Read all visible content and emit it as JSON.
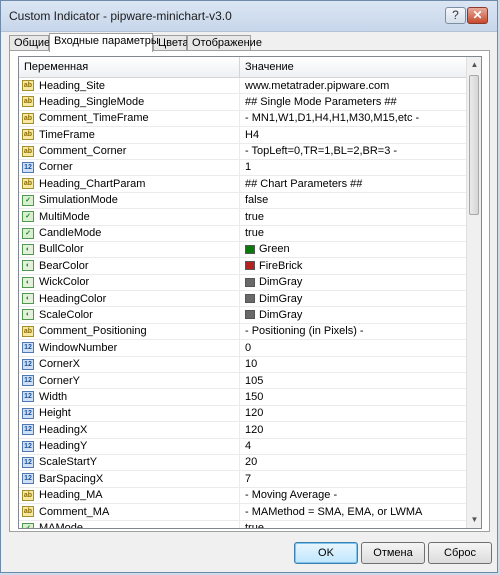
{
  "window": {
    "title": "Custom Indicator - pipware-minichart-v3.0",
    "help_label": "?",
    "close_label": "✕"
  },
  "tabs": [
    {
      "label": "Общие"
    },
    {
      "label": "Входные параметры"
    },
    {
      "label": "Цвета"
    },
    {
      "label": "Отображение"
    }
  ],
  "grid": {
    "col_name": "Переменная",
    "col_value": "Значение",
    "rows": [
      {
        "icon": "ab",
        "name": "Heading_Site",
        "value": "www.metatrader.pipware.com"
      },
      {
        "icon": "ab",
        "name": "Heading_SingleMode",
        "value": "## Single Mode Parameters ##"
      },
      {
        "icon": "ab",
        "name": "Comment_TimeFrame",
        "value": " - MN1,W1,D1,H4,H1,M30,M15,etc -"
      },
      {
        "icon": "ab",
        "name": "TimeFrame",
        "value": "H4"
      },
      {
        "icon": "ab",
        "name": "Comment_Corner",
        "value": " - TopLeft=0,TR=1,BL=2,BR=3 -"
      },
      {
        "icon": "num",
        "name": "Corner",
        "value": "1"
      },
      {
        "icon": "ab",
        "name": "Heading_ChartParam",
        "value": "## Chart Parameters ##"
      },
      {
        "icon": "bool",
        "name": "SimulationMode",
        "value": "false"
      },
      {
        "icon": "bool",
        "name": "MultiMode",
        "value": "true"
      },
      {
        "icon": "bool",
        "name": "CandleMode",
        "value": "true"
      },
      {
        "icon": "col",
        "name": "BullColor",
        "value": "Green",
        "swatch": "#0a7a0a"
      },
      {
        "icon": "col",
        "name": "BearColor",
        "value": "FireBrick",
        "swatch": "#b22222"
      },
      {
        "icon": "col",
        "name": "WickColor",
        "value": "DimGray",
        "swatch": "#696969"
      },
      {
        "icon": "col",
        "name": "HeadingColor",
        "value": "DimGray",
        "swatch": "#696969"
      },
      {
        "icon": "col",
        "name": "ScaleColor",
        "value": "DimGray",
        "swatch": "#696969"
      },
      {
        "icon": "ab",
        "name": "Comment_Positioning",
        "value": " - Positioning (in Pixels) -"
      },
      {
        "icon": "num",
        "name": "WindowNumber",
        "value": "0"
      },
      {
        "icon": "num",
        "name": "CornerX",
        "value": "10"
      },
      {
        "icon": "num",
        "name": "CornerY",
        "value": "105"
      },
      {
        "icon": "num",
        "name": "Width",
        "value": "150"
      },
      {
        "icon": "num",
        "name": "Height",
        "value": "120"
      },
      {
        "icon": "num",
        "name": "HeadingX",
        "value": "120"
      },
      {
        "icon": "num",
        "name": "HeadingY",
        "value": "4"
      },
      {
        "icon": "num",
        "name": "ScaleStartY",
        "value": "20"
      },
      {
        "icon": "num",
        "name": "BarSpacingX",
        "value": "7"
      },
      {
        "icon": "ab",
        "name": "Heading_MA",
        "value": " - Moving Average -"
      },
      {
        "icon": "ab",
        "name": "Comment_MA",
        "value": " - MAMethod = SMA, EMA, or LWMA"
      },
      {
        "icon": "bool",
        "name": "MAMode",
        "value": "true"
      }
    ]
  },
  "buttons": {
    "ok": "OK",
    "cancel": "Отмена",
    "reset": "Сброс"
  }
}
